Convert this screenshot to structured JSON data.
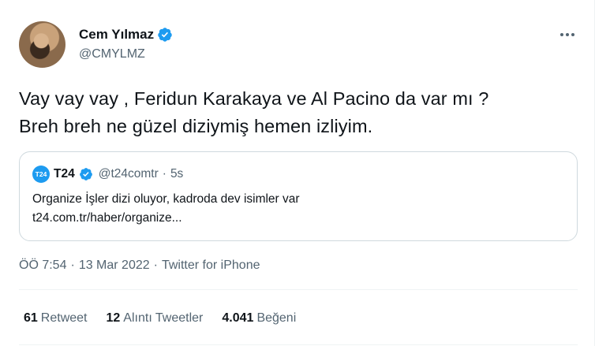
{
  "author": {
    "display_name": "Cem Yılmaz",
    "handle": "@CMYLMZ",
    "verified": true
  },
  "tweet": {
    "text_lines": [
      "Vay vay vay , Feridun Karakaya ve Al Pacino da var mı ?",
      "Breh breh ne güzel diziymiş hemen izliyim."
    ]
  },
  "quote": {
    "logo_text": "T24",
    "name": "T24",
    "handle": "@t24comtr",
    "separator": "·",
    "time": "5s",
    "line1": "Organize İşler dizi oluyor, kadroda dev isimler var",
    "line2": "t24.com.tr/haber/organize..."
  },
  "meta": {
    "time": "ÖÖ 7:54",
    "date": "13 Mar 2022",
    "separator": "·",
    "source": "Twitter for iPhone"
  },
  "stats": {
    "retweets": {
      "count": "61",
      "label": "Retweet"
    },
    "quotes": {
      "count": "12",
      "label": "Alıntı Tweetler"
    },
    "likes": {
      "count": "4.041",
      "label": "Beğeni"
    }
  },
  "colors": {
    "accent": "#1d9bf0",
    "text_primary": "#0f1419",
    "text_secondary": "#536471",
    "border": "#cfd9de"
  },
  "icons": {
    "verified": "verified-badge-icon",
    "more": "more-horizontal-icon"
  }
}
